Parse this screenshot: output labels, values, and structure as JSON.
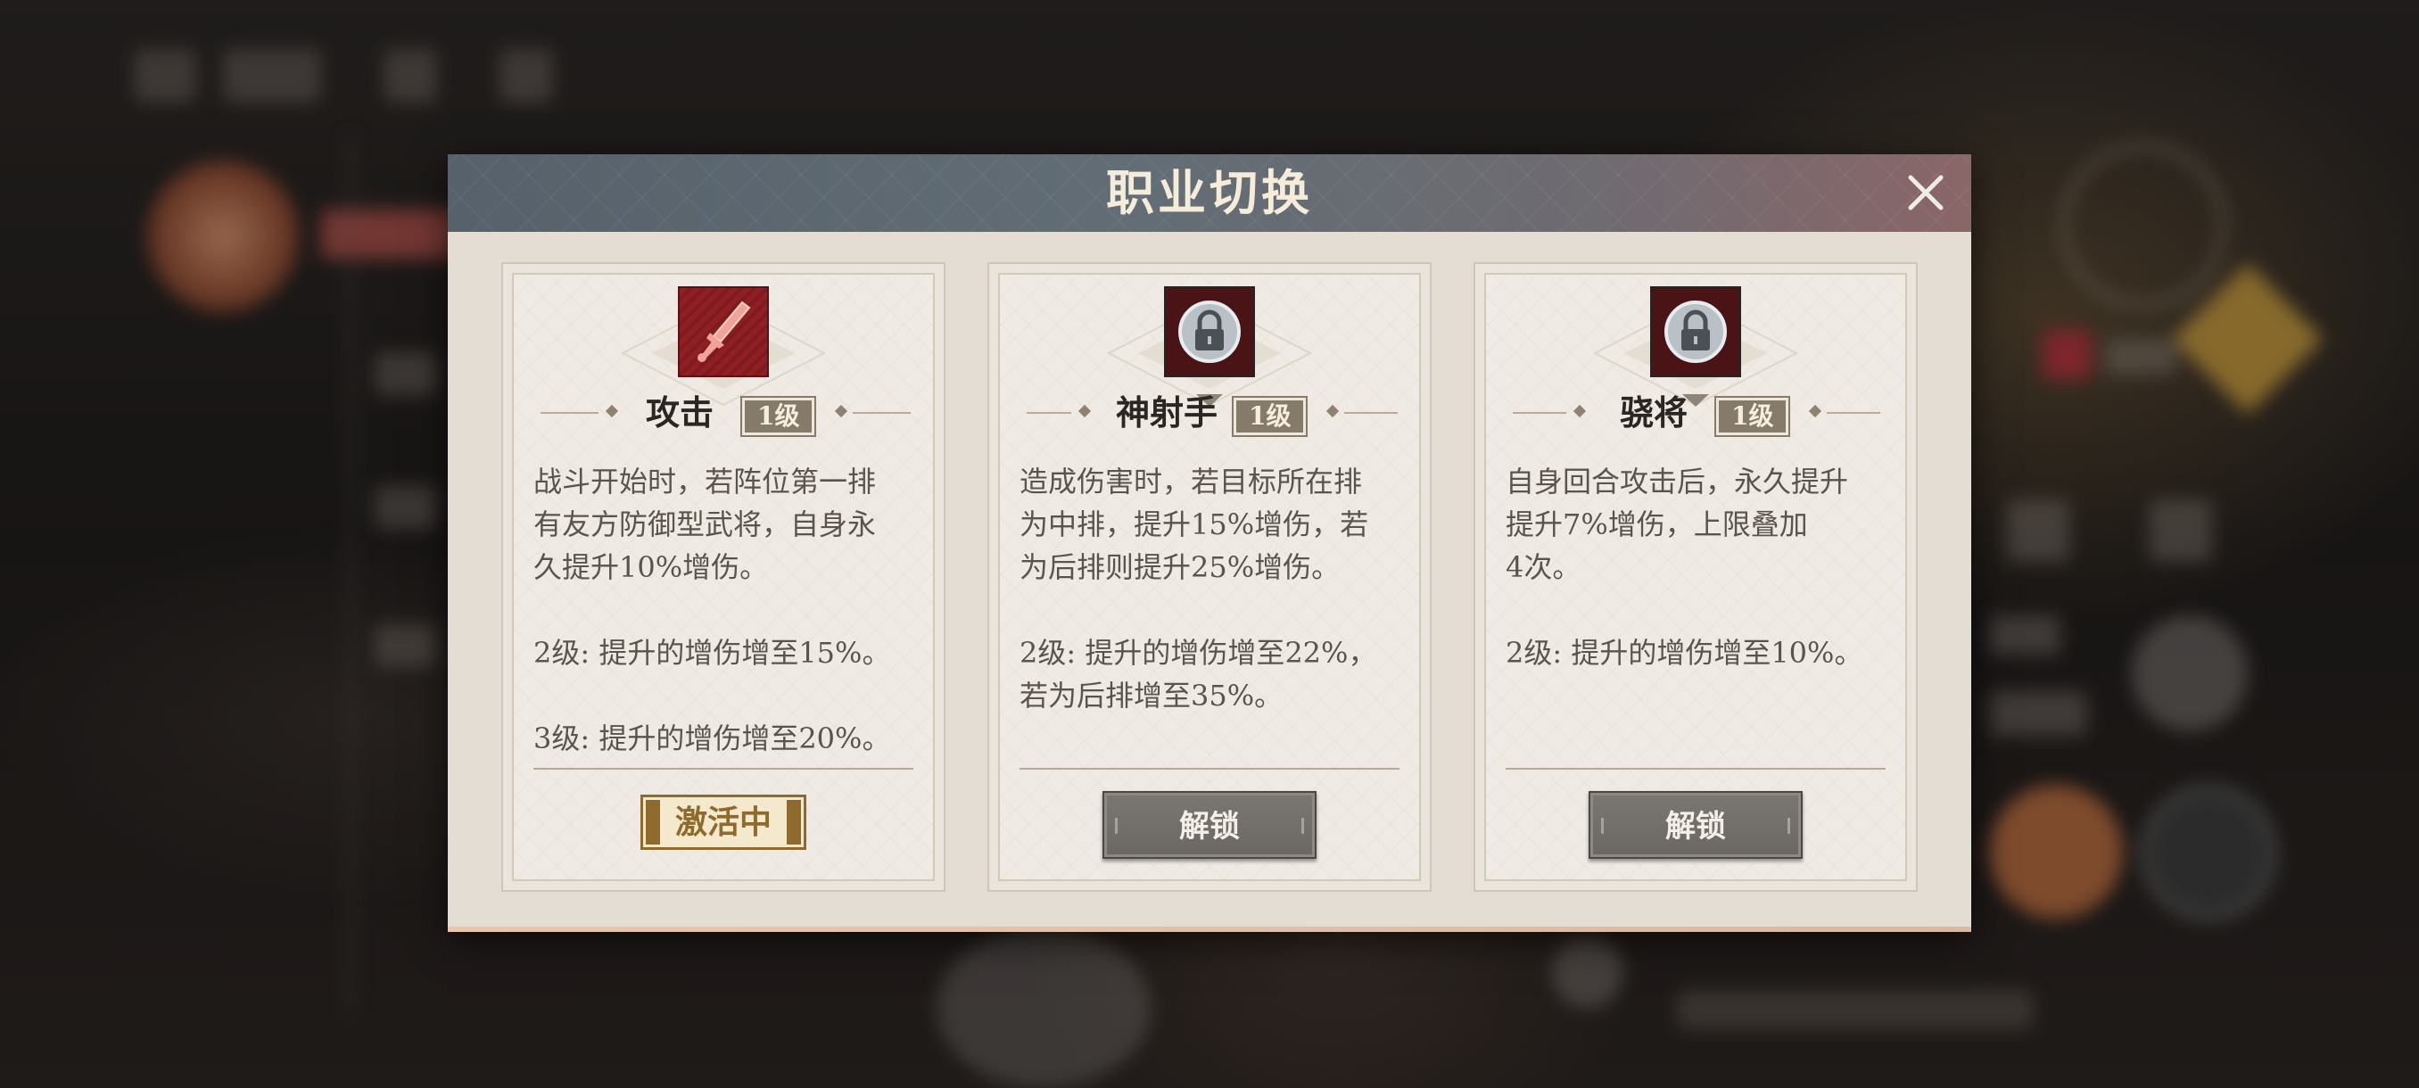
{
  "dialog": {
    "title": "职业切换",
    "close_icon": "close-icon"
  },
  "cards": [
    {
      "name": "攻击",
      "level": "1级",
      "icon": "sword-icon",
      "locked": false,
      "description": "战斗开始时，若阵位第一排\n有友方防御型武将，自身永\n久提升10%增伤。\n\n2级: 提升的增伤增至15%。\n\n3级: 提升的增伤增至20%。",
      "status": "激活中"
    },
    {
      "name": "神射手",
      "level": "1级",
      "icon": "lock-icon",
      "locked": true,
      "description": "造成伤害时，若目标所在排\n为中排，提升15%增伤，若\n为后排则提升25%增伤。\n\n2级: 提升的增伤增至22%，\n若为后排增至35%。",
      "action": "解锁"
    },
    {
      "name": "骁将",
      "level": "1级",
      "icon": "lock-icon",
      "locked": true,
      "description": "自身回合攻击后，永久提升\n提升7%增伤，上限叠加\n4次。\n\n2级: 提升的增伤增至10%。",
      "action": "解锁"
    }
  ],
  "colors": {
    "header_start": "#56616b",
    "header_end": "#8a6668",
    "panel_bg": "#e3ddd3",
    "icon_red": "#8f1f22",
    "active_gold": "#8e6a2c",
    "button_gray": "#737069"
  }
}
